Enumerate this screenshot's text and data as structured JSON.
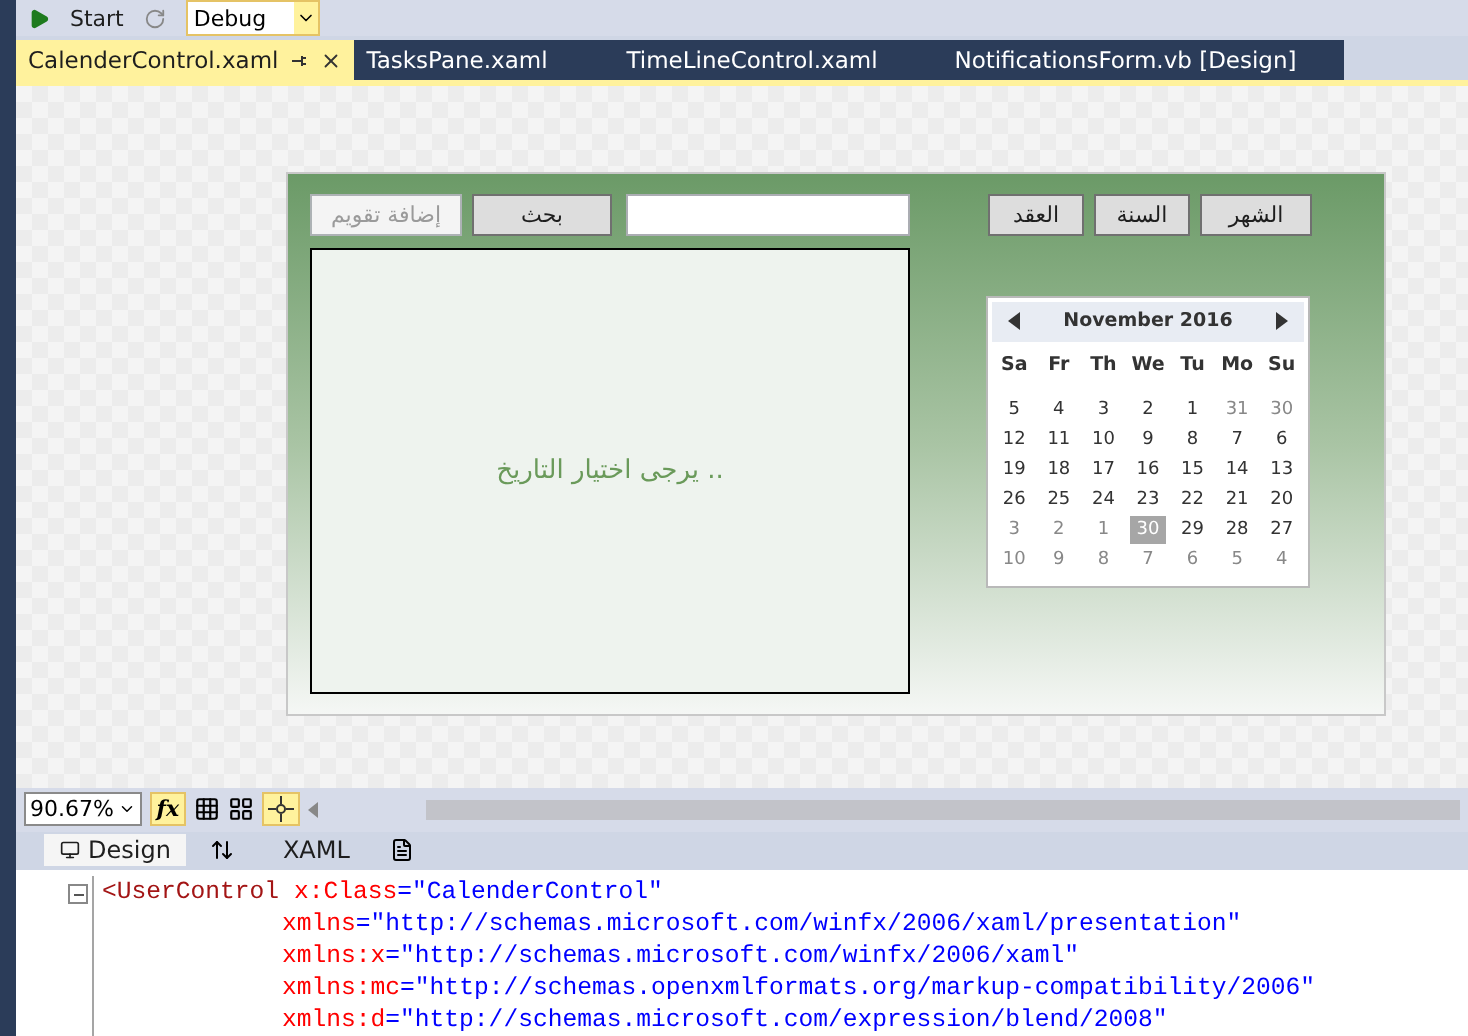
{
  "toolbar": {
    "start_label": "Start",
    "config_value": "Debug"
  },
  "doc_tabs": [
    {
      "label": "CalenderControl.xaml",
      "selected": true
    },
    {
      "label": "TasksPane.xaml",
      "selected": false
    },
    {
      "label": "TimeLineControl.xaml",
      "selected": false
    },
    {
      "label": "NotificationsForm.vb [Design]",
      "selected": false
    }
  ],
  "form": {
    "left_buttons": [
      {
        "label": "بحث",
        "disabled": false
      },
      {
        "label": "إضافة تقويم",
        "disabled": true
      }
    ],
    "right_buttons": [
      "الشهر",
      "السنة",
      "العقد"
    ],
    "message": "يرجى اختيار التاريخ ..",
    "calendar": {
      "title": "November 2016",
      "weekdays": [
        "Sa",
        "Fr",
        "Th",
        "We",
        "Tu",
        "Mo",
        "Su"
      ],
      "weeks": [
        [
          {
            "day": "5",
            "muted": false,
            "selected": false
          },
          {
            "day": "4",
            "muted": false,
            "selected": false
          },
          {
            "day": "3",
            "muted": false,
            "selected": false
          },
          {
            "day": "2",
            "muted": false,
            "selected": false
          },
          {
            "day": "1",
            "muted": false,
            "selected": false
          },
          {
            "day": "31",
            "muted": true,
            "selected": false
          },
          {
            "day": "30",
            "muted": true,
            "selected": false
          }
        ],
        [
          {
            "day": "12",
            "muted": false,
            "selected": false
          },
          {
            "day": "11",
            "muted": false,
            "selected": false
          },
          {
            "day": "10",
            "muted": false,
            "selected": false
          },
          {
            "day": "9",
            "muted": false,
            "selected": false
          },
          {
            "day": "8",
            "muted": false,
            "selected": false
          },
          {
            "day": "7",
            "muted": false,
            "selected": false
          },
          {
            "day": "6",
            "muted": false,
            "selected": false
          }
        ],
        [
          {
            "day": "19",
            "muted": false,
            "selected": false
          },
          {
            "day": "18",
            "muted": false,
            "selected": false
          },
          {
            "day": "17",
            "muted": false,
            "selected": false
          },
          {
            "day": "16",
            "muted": false,
            "selected": false
          },
          {
            "day": "15",
            "muted": false,
            "selected": false
          },
          {
            "day": "14",
            "muted": false,
            "selected": false
          },
          {
            "day": "13",
            "muted": false,
            "selected": false
          }
        ],
        [
          {
            "day": "26",
            "muted": false,
            "selected": false
          },
          {
            "day": "25",
            "muted": false,
            "selected": false
          },
          {
            "day": "24",
            "muted": false,
            "selected": false
          },
          {
            "day": "23",
            "muted": false,
            "selected": false
          },
          {
            "day": "22",
            "muted": false,
            "selected": false
          },
          {
            "day": "21",
            "muted": false,
            "selected": false
          },
          {
            "day": "20",
            "muted": false,
            "selected": false
          }
        ],
        [
          {
            "day": "3",
            "muted": true,
            "selected": false
          },
          {
            "day": "2",
            "muted": true,
            "selected": false
          },
          {
            "day": "1",
            "muted": true,
            "selected": false
          },
          {
            "day": "30",
            "muted": false,
            "selected": true
          },
          {
            "day": "29",
            "muted": false,
            "selected": false
          },
          {
            "day": "28",
            "muted": false,
            "selected": false
          },
          {
            "day": "27",
            "muted": false,
            "selected": false
          }
        ],
        [
          {
            "day": "10",
            "muted": true,
            "selected": false
          },
          {
            "day": "9",
            "muted": true,
            "selected": false
          },
          {
            "day": "8",
            "muted": true,
            "selected": false
          },
          {
            "day": "7",
            "muted": true,
            "selected": false
          },
          {
            "day": "6",
            "muted": true,
            "selected": false
          },
          {
            "day": "5",
            "muted": true,
            "selected": false
          },
          {
            "day": "4",
            "muted": true,
            "selected": false
          }
        ]
      ]
    }
  },
  "zoom_bar": {
    "zoom_value": "90.67%",
    "fx_label": "fx",
    "fx_on": true,
    "snap_on": true
  },
  "view_tabs": [
    {
      "label": "Design",
      "selected": true
    },
    {
      "label": "XAML",
      "selected": false
    }
  ],
  "code_lines": [
    [
      {
        "kind": "tag",
        "text": "<UserControl"
      },
      {
        "kind": "attr",
        "text": " x:Class"
      },
      {
        "kind": "value",
        "text": "=\"CalenderControl\""
      }
    ],
    [
      {
        "kind": "attr",
        "text": "xmlns"
      },
      {
        "kind": "value",
        "text": "=\"http://schemas.microsoft.com/winfx/2006/xaml/presentation\""
      }
    ],
    [
      {
        "kind": "attr",
        "text": "xmlns:x"
      },
      {
        "kind": "value",
        "text": "=\"http://schemas.microsoft.com/winfx/2006/xaml\""
      }
    ],
    [
      {
        "kind": "attr",
        "text": "xmlns:mc"
      },
      {
        "kind": "value",
        "text": "=\"http://schemas.openxmlformats.org/markup-compatibility/2006\""
      }
    ],
    [
      {
        "kind": "attr",
        "text": "xmlns:d"
      },
      {
        "kind": "value",
        "text": "=\"http://schemas.microsoft.com/expression/blend/2008\""
      }
    ]
  ]
}
